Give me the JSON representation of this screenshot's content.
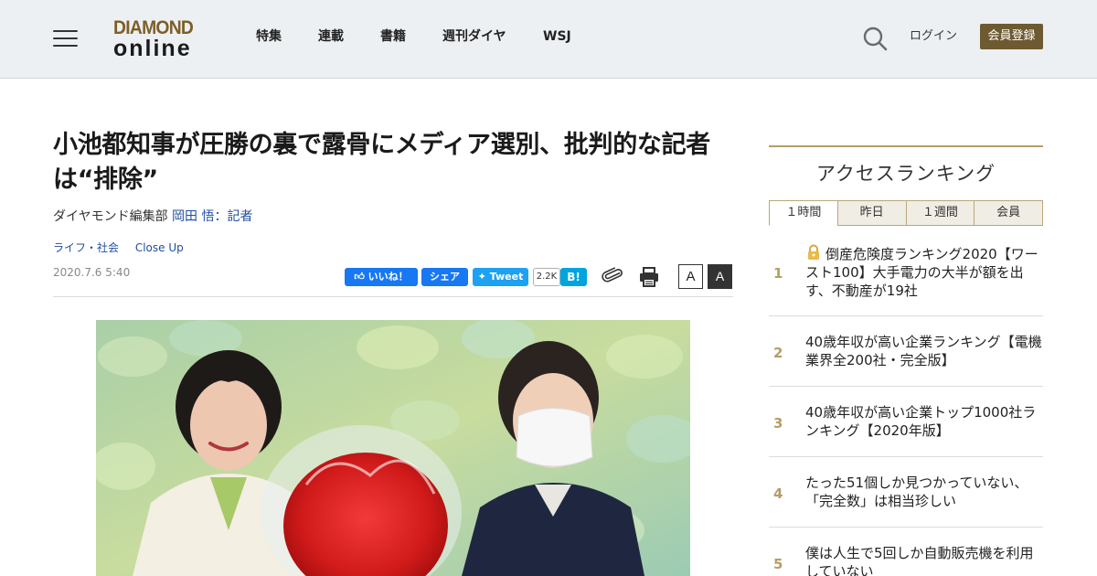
{
  "header": {
    "logo_top": "DIAMOND",
    "logo_bottom": "online",
    "nav": [
      "特集",
      "連載",
      "書籍",
      "週刊ダイヤ",
      "WSJ"
    ],
    "login": "ログイン",
    "register": "会員登録",
    "colors": {
      "background": "#edf0f3",
      "register_button": "#6e5a31",
      "logo_gold": "#7c5f27"
    }
  },
  "article": {
    "title": "小池都知事が圧勝の裏で露骨にメディア選別、批判的な記者は“排除”",
    "author_prefix": "ダイヤモンド編集部",
    "author_link": "岡田 悟：記者",
    "tags": [
      "ライフ・社会",
      "Close Up"
    ],
    "date": "2020.7.6 5:40",
    "share": {
      "fb_like": "いいね！",
      "fb_share": "シェア",
      "tweet": "Tweet",
      "hatena_count": "2.2K",
      "hatena_label": "B!"
    },
    "font_size_small": "A",
    "font_size_large": "A"
  },
  "sidebar": {
    "title": "アクセスランキング",
    "tabs": [
      "１時間",
      "昨日",
      "１週間",
      "会員"
    ],
    "active_tab": "１時間",
    "items": [
      {
        "rank": "1",
        "title": "倒産危険度ランキング2020【ワースト100】大手電力の大半が額を出す、不動産が19社",
        "locked": true
      },
      {
        "rank": "2",
        "title": "40歳年収が高い企業ランキング【電機業界全200社・完全版】",
        "locked": false
      },
      {
        "rank": "3",
        "title": "40歳年収が高い企業トップ1000社ランキング【2020年版】",
        "locked": false
      },
      {
        "rank": "4",
        "title": "たった51個しか見つかっていない、「完全数」は相当珍しい",
        "locked": false
      },
      {
        "rank": "5",
        "title": "僕は人生で5回しか自動販売機を利用していない",
        "locked": false
      }
    ]
  }
}
